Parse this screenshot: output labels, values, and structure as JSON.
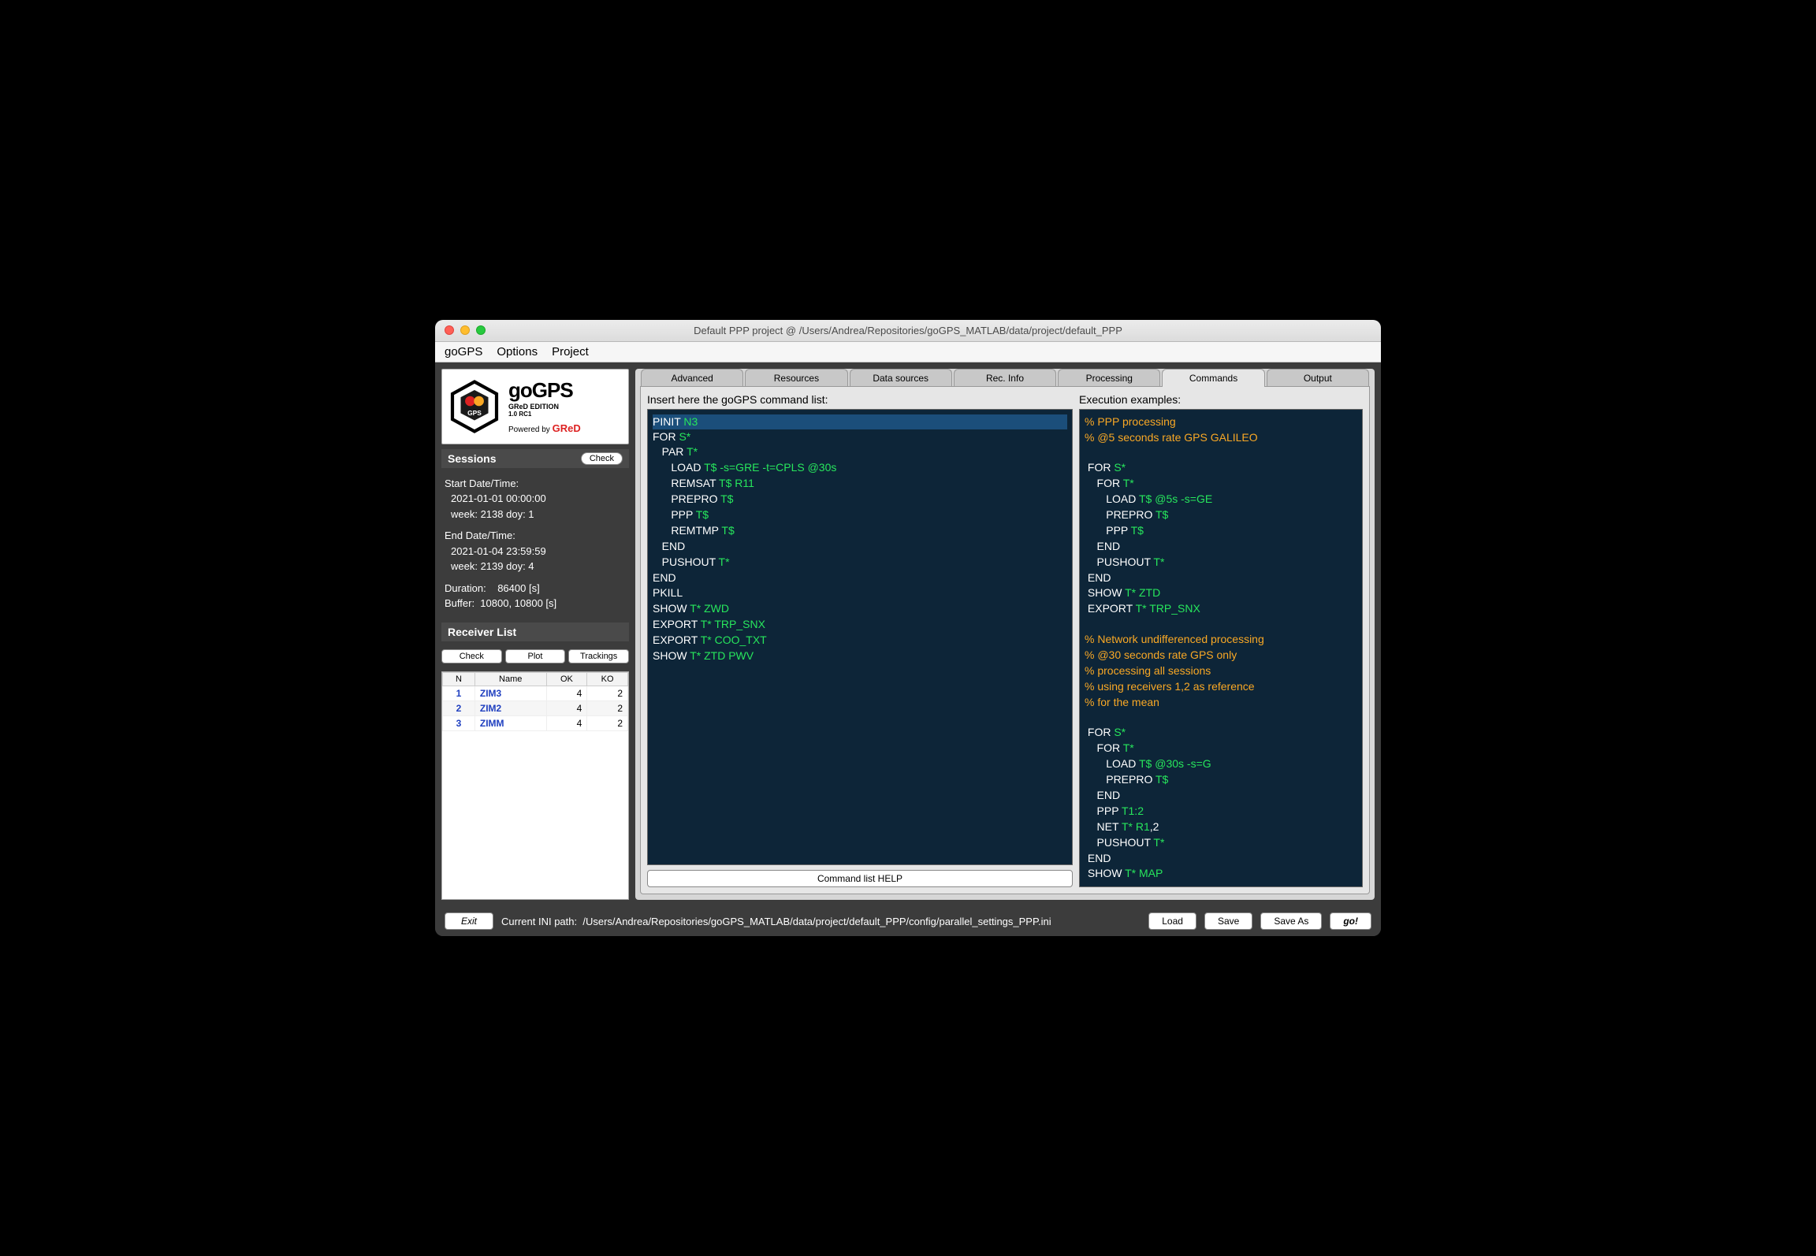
{
  "window": {
    "title": "Default PPP project @ /Users/Andrea/Repositories/goGPS_MATLAB/data/project/default_PPP"
  },
  "menu": [
    "goGPS",
    "Options",
    "Project"
  ],
  "logo": {
    "title": "goGPS",
    "subtitle": "GReD EDITION",
    "version": "1.0 RC1",
    "powered_prefix": "Powered by ",
    "powered_brand": "GReD"
  },
  "sessions": {
    "heading": "Sessions",
    "check": "Check",
    "start_label": "Start Date/Time:",
    "start_value": "2021-01-01  00:00:00",
    "start_week": "week: 2138 doy: 1",
    "end_label": "End Date/Time:",
    "end_value": "2021-01-04  23:59:59",
    "end_week": "week: 2139 doy: 4",
    "duration_label": "Duration:",
    "duration_value": "86400 [s]",
    "buffer_label": "Buffer:",
    "buffer_value": "10800,  10800 [s]"
  },
  "receiver": {
    "heading": "Receiver List",
    "buttons": {
      "check": "Check",
      "plot": "Plot",
      "trackings": "Trackings"
    },
    "cols": [
      "N",
      "Name",
      "OK",
      "KO"
    ],
    "rows": [
      {
        "n": "1",
        "name": "ZIM3",
        "ok": "4",
        "ko": "2"
      },
      {
        "n": "2",
        "name": "ZIM2",
        "ok": "4",
        "ko": "2"
      },
      {
        "n": "3",
        "name": "ZIMM",
        "ok": "4",
        "ko": "2"
      }
    ]
  },
  "tabs": [
    "Advanced",
    "Resources",
    "Data sources",
    "Rec. Info",
    "Processing",
    "Commands",
    "Output"
  ],
  "active_tab": 5,
  "cmd": {
    "insert_label": "Insert here the goGPS command list:",
    "exec_label": "Execution examples:",
    "help": "Command list HELP"
  },
  "footer": {
    "exit": "Exit",
    "ini_label": "Current INI path:",
    "ini_path": "/Users/Andrea/Repositories/goGPS_MATLAB/data/project/default_PPP/config/parallel_settings_PPP.ini",
    "load": "Load",
    "save": "Save",
    "saveas": "Save As",
    "go": "go!"
  },
  "commands_left": [
    {
      "t": "kw",
      "s": "PINIT ",
      "hl": true
    },
    {
      "t": "arg",
      "s": "N3",
      "hl": true
    },
    {
      "t": "nl"
    },
    {
      "t": "kw",
      "s": "FOR "
    },
    {
      "t": "arg",
      "s": "S*"
    },
    {
      "t": "nl"
    },
    {
      "t": "kw",
      "s": "   PAR "
    },
    {
      "t": "arg",
      "s": "T*"
    },
    {
      "t": "nl"
    },
    {
      "t": "kw",
      "s": "      LOAD "
    },
    {
      "t": "arg",
      "s": "T$ -s=GRE -t=CPLS @30s"
    },
    {
      "t": "nl"
    },
    {
      "t": "kw",
      "s": "      REMSAT "
    },
    {
      "t": "arg",
      "s": "T$ R11"
    },
    {
      "t": "nl"
    },
    {
      "t": "kw",
      "s": "      PREPRO "
    },
    {
      "t": "arg",
      "s": "T$"
    },
    {
      "t": "nl"
    },
    {
      "t": "kw",
      "s": "      PPP "
    },
    {
      "t": "arg",
      "s": "T$"
    },
    {
      "t": "nl"
    },
    {
      "t": "kw",
      "s": "      REMTMP "
    },
    {
      "t": "arg",
      "s": "T$"
    },
    {
      "t": "nl"
    },
    {
      "t": "kw",
      "s": "   END"
    },
    {
      "t": "nl"
    },
    {
      "t": "kw",
      "s": "   PUSHOUT "
    },
    {
      "t": "arg",
      "s": "T*"
    },
    {
      "t": "nl"
    },
    {
      "t": "kw",
      "s": "END"
    },
    {
      "t": "nl"
    },
    {
      "t": "kw",
      "s": "PKILL"
    },
    {
      "t": "nl"
    },
    {
      "t": "kw",
      "s": "SHOW "
    },
    {
      "t": "arg",
      "s": "T* ZWD"
    },
    {
      "t": "nl"
    },
    {
      "t": "kw",
      "s": "EXPORT "
    },
    {
      "t": "arg",
      "s": "T* TRP_SNX"
    },
    {
      "t": "nl"
    },
    {
      "t": "kw",
      "s": "EXPORT "
    },
    {
      "t": "arg",
      "s": "T* COO_TXT"
    },
    {
      "t": "nl"
    },
    {
      "t": "kw",
      "s": "SHOW "
    },
    {
      "t": "arg",
      "s": "T* ZTD PWV"
    },
    {
      "t": "nl"
    }
  ],
  "commands_right": [
    {
      "t": "cm",
      "s": "% PPP processing"
    },
    {
      "t": "nl"
    },
    {
      "t": "cm",
      "s": "% @5 seconds rate GPS GALILEO"
    },
    {
      "t": "nl"
    },
    {
      "t": "nl"
    },
    {
      "t": "kw",
      "s": " FOR "
    },
    {
      "t": "arg",
      "s": "S*"
    },
    {
      "t": "nl"
    },
    {
      "t": "kw",
      "s": "    FOR "
    },
    {
      "t": "arg",
      "s": "T*"
    },
    {
      "t": "nl"
    },
    {
      "t": "kw",
      "s": "       LOAD "
    },
    {
      "t": "arg",
      "s": "T$ @5s -s=GE"
    },
    {
      "t": "nl"
    },
    {
      "t": "kw",
      "s": "       PREPRO "
    },
    {
      "t": "arg",
      "s": "T$"
    },
    {
      "t": "nl"
    },
    {
      "t": "kw",
      "s": "       PPP "
    },
    {
      "t": "arg",
      "s": "T$"
    },
    {
      "t": "nl"
    },
    {
      "t": "kw",
      "s": "    END"
    },
    {
      "t": "nl"
    },
    {
      "t": "kw",
      "s": "    PUSHOUT "
    },
    {
      "t": "arg",
      "s": "T*"
    },
    {
      "t": "nl"
    },
    {
      "t": "kw",
      "s": " END"
    },
    {
      "t": "nl"
    },
    {
      "t": "kw",
      "s": " SHOW "
    },
    {
      "t": "arg",
      "s": "T* ZTD"
    },
    {
      "t": "nl"
    },
    {
      "t": "kw",
      "s": " EXPORT "
    },
    {
      "t": "arg",
      "s": "T* TRP_SNX"
    },
    {
      "t": "nl"
    },
    {
      "t": "nl"
    },
    {
      "t": "cm",
      "s": "% Network undifferenced processing"
    },
    {
      "t": "nl"
    },
    {
      "t": "cm",
      "s": "% @30 seconds rate GPS only"
    },
    {
      "t": "nl"
    },
    {
      "t": "cm",
      "s": "% processing all sessions"
    },
    {
      "t": "nl"
    },
    {
      "t": "cm",
      "s": "% using receivers 1,2 as reference"
    },
    {
      "t": "nl"
    },
    {
      "t": "cm",
      "s": "% for the mean"
    },
    {
      "t": "nl"
    },
    {
      "t": "nl"
    },
    {
      "t": "kw",
      "s": " FOR "
    },
    {
      "t": "arg",
      "s": "S*"
    },
    {
      "t": "nl"
    },
    {
      "t": "kw",
      "s": "    FOR "
    },
    {
      "t": "arg",
      "s": "T*"
    },
    {
      "t": "nl"
    },
    {
      "t": "kw",
      "s": "       LOAD "
    },
    {
      "t": "arg",
      "s": "T$ @30s -s=G"
    },
    {
      "t": "nl"
    },
    {
      "t": "kw",
      "s": "       PREPRO "
    },
    {
      "t": "arg",
      "s": "T$"
    },
    {
      "t": "nl"
    },
    {
      "t": "kw",
      "s": "    END"
    },
    {
      "t": "nl"
    },
    {
      "t": "kw",
      "s": "    PPP "
    },
    {
      "t": "arg",
      "s": "T1:2"
    },
    {
      "t": "nl"
    },
    {
      "t": "kw",
      "s": "    NET "
    },
    {
      "t": "arg",
      "s": "T* R1"
    },
    {
      "t": "kw",
      "s": ",2"
    },
    {
      "t": "nl"
    },
    {
      "t": "kw",
      "s": "    PUSHOUT "
    },
    {
      "t": "arg",
      "s": "T*"
    },
    {
      "t": "nl"
    },
    {
      "t": "kw",
      "s": " END"
    },
    {
      "t": "nl"
    },
    {
      "t": "kw",
      "s": " SHOW "
    },
    {
      "t": "arg",
      "s": "T* MAP"
    },
    {
      "t": "nl"
    }
  ]
}
